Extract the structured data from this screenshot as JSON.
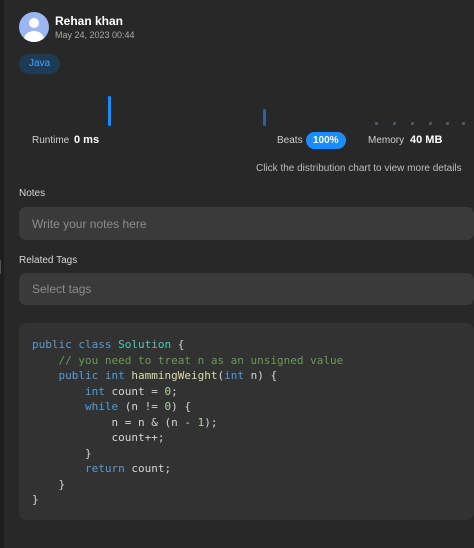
{
  "user": {
    "name": "Rehan khan",
    "timestamp": "May 24, 2023 00:44"
  },
  "language_badge": "Java",
  "stats": {
    "runtime_label": "Runtime",
    "runtime_value": "0 ms",
    "beats_label": "Beats",
    "beats_value": "100%",
    "memory_label": "Memory",
    "memory_value": "40 MB"
  },
  "hint_text": "Click the distribution chart to view more details",
  "notes": {
    "label": "Notes",
    "placeholder": "Write your notes here"
  },
  "tags": {
    "label": "Related Tags",
    "placeholder": "Select tags"
  },
  "colors": {
    "accent": "#1a8cff",
    "background": "#282828",
    "field": "#3a3a3a",
    "code_background": "#323232"
  },
  "code": {
    "language": "java",
    "lines": [
      [
        {
          "t": "public class ",
          "c": "kw"
        },
        {
          "t": "Solution",
          "c": "cls"
        },
        {
          "t": " {",
          "c": ""
        }
      ],
      [
        {
          "t": "    ",
          "c": ""
        },
        {
          "t": "// you need to treat n as an unsigned value",
          "c": "cmt"
        }
      ],
      [
        {
          "t": "    ",
          "c": ""
        },
        {
          "t": "public int ",
          "c": "kw"
        },
        {
          "t": "hammingWeight",
          "c": "fn"
        },
        {
          "t": "(",
          "c": ""
        },
        {
          "t": "int",
          "c": "kw"
        },
        {
          "t": " n) {",
          "c": ""
        }
      ],
      [
        {
          "t": "        ",
          "c": ""
        },
        {
          "t": "int",
          "c": "kw"
        },
        {
          "t": " count = ",
          "c": ""
        },
        {
          "t": "0",
          "c": "num"
        },
        {
          "t": ";",
          "c": ""
        }
      ],
      [
        {
          "t": "        ",
          "c": ""
        },
        {
          "t": "while",
          "c": "kw"
        },
        {
          "t": " (n != ",
          "c": ""
        },
        {
          "t": "0",
          "c": "num"
        },
        {
          "t": ") {",
          "c": ""
        }
      ],
      [
        {
          "t": "            n = n & (n - ",
          "c": ""
        },
        {
          "t": "1",
          "c": "num"
        },
        {
          "t": ");",
          "c": ""
        }
      ],
      [
        {
          "t": "            count++;",
          "c": ""
        }
      ],
      [
        {
          "t": "        }",
          "c": ""
        }
      ],
      [
        {
          "t": "        ",
          "c": ""
        },
        {
          "t": "return",
          "c": "kw"
        },
        {
          "t": " count;",
          "c": ""
        }
      ],
      [
        {
          "t": "    }",
          "c": ""
        }
      ],
      [
        {
          "t": "}",
          "c": ""
        }
      ]
    ]
  }
}
